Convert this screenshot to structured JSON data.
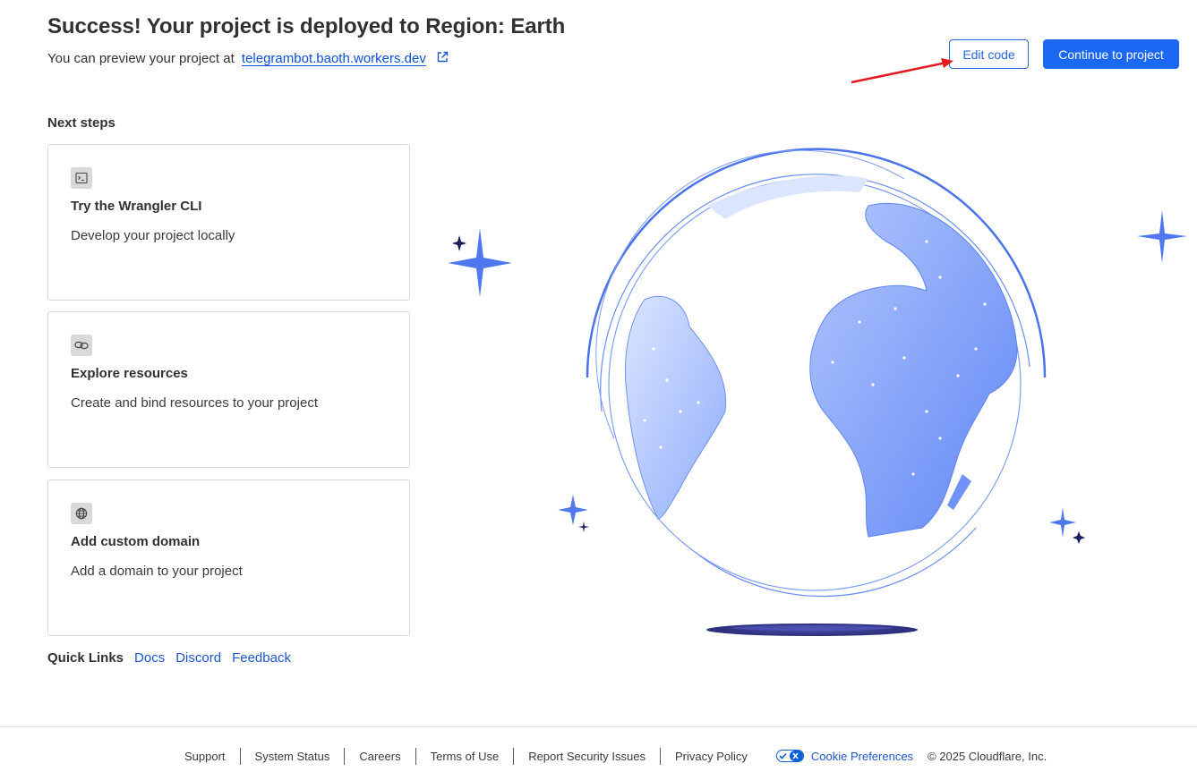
{
  "header": {
    "title": "Success! Your project is deployed to Region: Earth",
    "preview_prefix": "You can preview your project at",
    "preview_link": "telegrambot.baoth.workers.dev",
    "edit_code_label": "Edit code",
    "continue_label": "Continue to project"
  },
  "next_steps": {
    "label": "Next steps",
    "cards": [
      {
        "icon": "terminal-icon",
        "title": "Try the Wrangler CLI",
        "description": "Develop your project locally"
      },
      {
        "icon": "link-icon",
        "title": "Explore resources",
        "description": "Create and bind resources to your project"
      },
      {
        "icon": "globe-icon",
        "title": "Add custom domain",
        "description": "Add a domain to your project"
      }
    ]
  },
  "quick_links": {
    "label": "Quick Links",
    "links": [
      "Docs",
      "Discord",
      "Feedback"
    ]
  },
  "footer": {
    "items": [
      "Support",
      "System Status",
      "Careers",
      "Terms of Use",
      "Report Security Issues",
      "Privacy Policy"
    ],
    "cookie_label": "Cookie Preferences",
    "copyright": "© 2025 Cloudflare, Inc."
  },
  "colors": {
    "primary": "#1b68f2",
    "link": "#1f57c7",
    "annotation_arrow": "#e01c1c",
    "globe_blue": "#5c85f5"
  }
}
